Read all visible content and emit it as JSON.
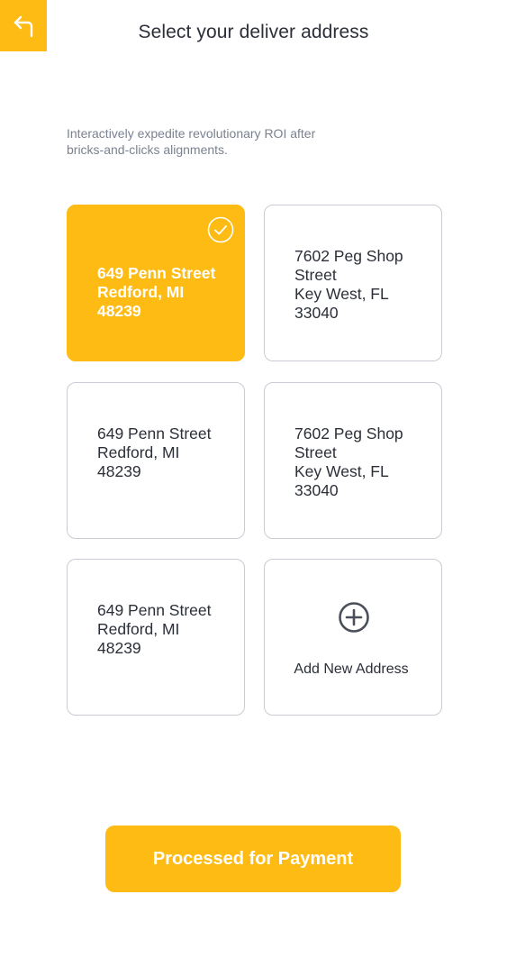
{
  "header": {
    "title": "Select your deliver address",
    "back_icon": "back-arrow-icon"
  },
  "subtitle": "Interactively expedite revolutionary ROI after bricks-and-clicks alignments.",
  "addresses": [
    {
      "line1": "649 Penn Street",
      "line2": "Redford, MI",
      "line3": "48239",
      "selected": true
    },
    {
      "line1": "7602 Peg Shop Street",
      "line2": "Key West, FL",
      "line3": "33040",
      "selected": false
    },
    {
      "line1": "649 Penn Street",
      "line2": "Redford, MI",
      "line3": "48239",
      "selected": false
    },
    {
      "line1": "7602 Peg Shop Street",
      "line2": "Key West, FL",
      "line3": "33040",
      "selected": false
    },
    {
      "line1": "649 Penn Street",
      "line2": "Redford, MI",
      "line3": "48239",
      "selected": false
    }
  ],
  "add_address": {
    "label": "Add New Address",
    "icon": "plus-circle-icon"
  },
  "pay_button": {
    "label": "Processed for Payment"
  },
  "colors": {
    "accent": "#fdbb13",
    "text": "#2b2f38",
    "muted": "#7a8190",
    "border": "#c9ccd3"
  }
}
